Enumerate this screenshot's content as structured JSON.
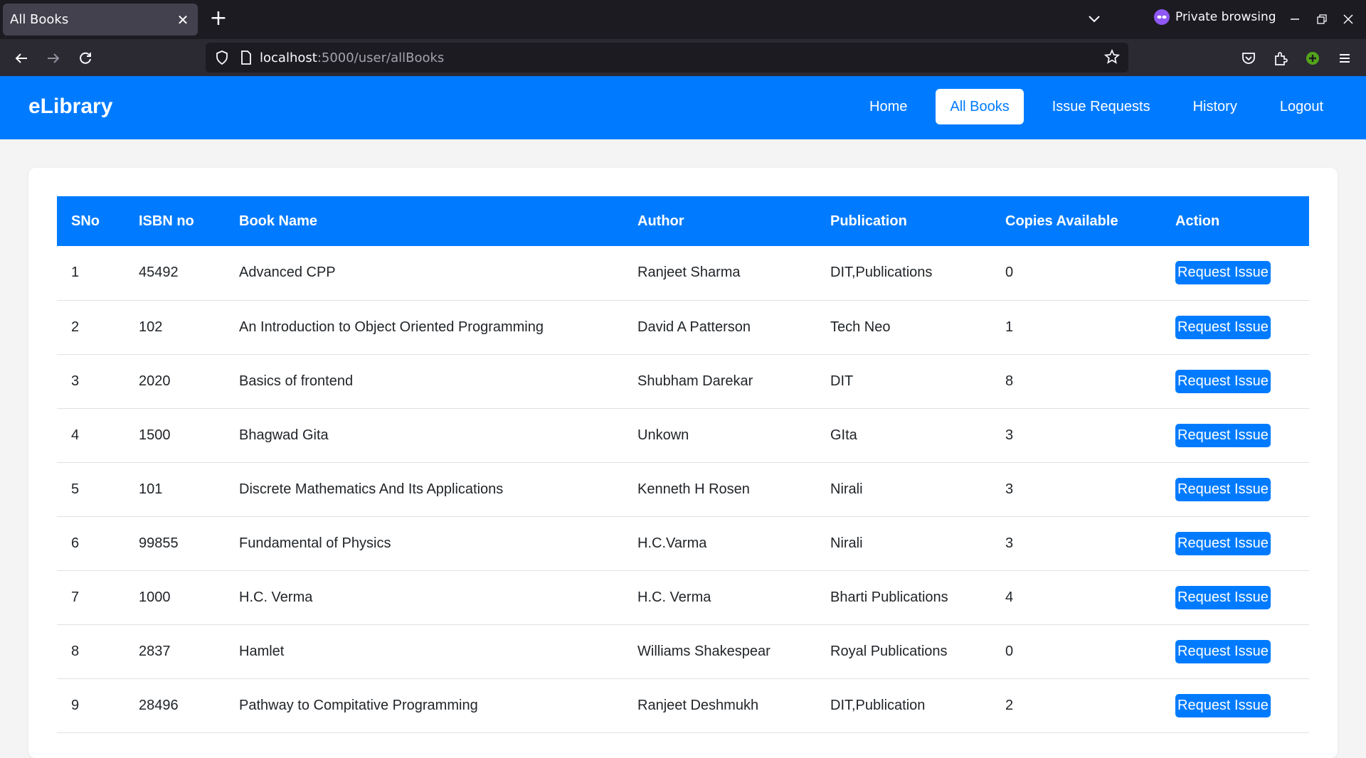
{
  "browser": {
    "tab_title": "All Books",
    "url_host": "localhost",
    "url_rest": ":5000/user/allBooks",
    "private_label": "Private browsing"
  },
  "app": {
    "brand": "eLibrary",
    "nav": [
      {
        "label": "Home",
        "active": false
      },
      {
        "label": "All Books",
        "active": true
      },
      {
        "label": "Issue Requests",
        "active": false
      },
      {
        "label": "History",
        "active": false
      },
      {
        "label": "Logout",
        "active": false
      }
    ]
  },
  "table": {
    "headers": [
      "SNo",
      "ISBN no",
      "Book Name",
      "Author",
      "Publication",
      "Copies Available",
      "Action"
    ],
    "action_label": "Request Issue",
    "rows": [
      {
        "sno": "1",
        "isbn": "45492",
        "name": "Advanced CPP",
        "author": "Ranjeet Sharma",
        "publication": "DIT,Publications",
        "copies": "0"
      },
      {
        "sno": "2",
        "isbn": "102",
        "name": "An Introduction to Object Oriented Programming",
        "author": "David A Patterson",
        "publication": "Tech Neo",
        "copies": "1"
      },
      {
        "sno": "3",
        "isbn": "2020",
        "name": "Basics of frontend",
        "author": "Shubham Darekar",
        "publication": "DIT",
        "copies": "8"
      },
      {
        "sno": "4",
        "isbn": "1500",
        "name": "Bhagwad Gita",
        "author": "Unkown",
        "publication": "GIta",
        "copies": "3"
      },
      {
        "sno": "5",
        "isbn": "101",
        "name": "Discrete Mathematics And Its Applications",
        "author": "Kenneth H Rosen",
        "publication": "Nirali",
        "copies": "3"
      },
      {
        "sno": "6",
        "isbn": "99855",
        "name": "Fundamental of Physics",
        "author": "H.C.Varma",
        "publication": "Nirali",
        "copies": "3"
      },
      {
        "sno": "7",
        "isbn": "1000",
        "name": "H.C. Verma",
        "author": "H.C. Verma",
        "publication": "Bharti Publications",
        "copies": "4"
      },
      {
        "sno": "8",
        "isbn": "2837",
        "name": "Hamlet",
        "author": "Williams Shakespear",
        "publication": "Royal Publications",
        "copies": "0"
      },
      {
        "sno": "9",
        "isbn": "28496",
        "name": "Pathway to Compitative Programming",
        "author": "Ranjeet Deshmukh",
        "publication": "DIT,Publication",
        "copies": "2"
      }
    ]
  },
  "colors": {
    "primary": "#007bff",
    "page_bg": "#f3f4f3",
    "chrome_dark": "#1c1b22",
    "chrome_toolbar": "#2b2a33"
  }
}
